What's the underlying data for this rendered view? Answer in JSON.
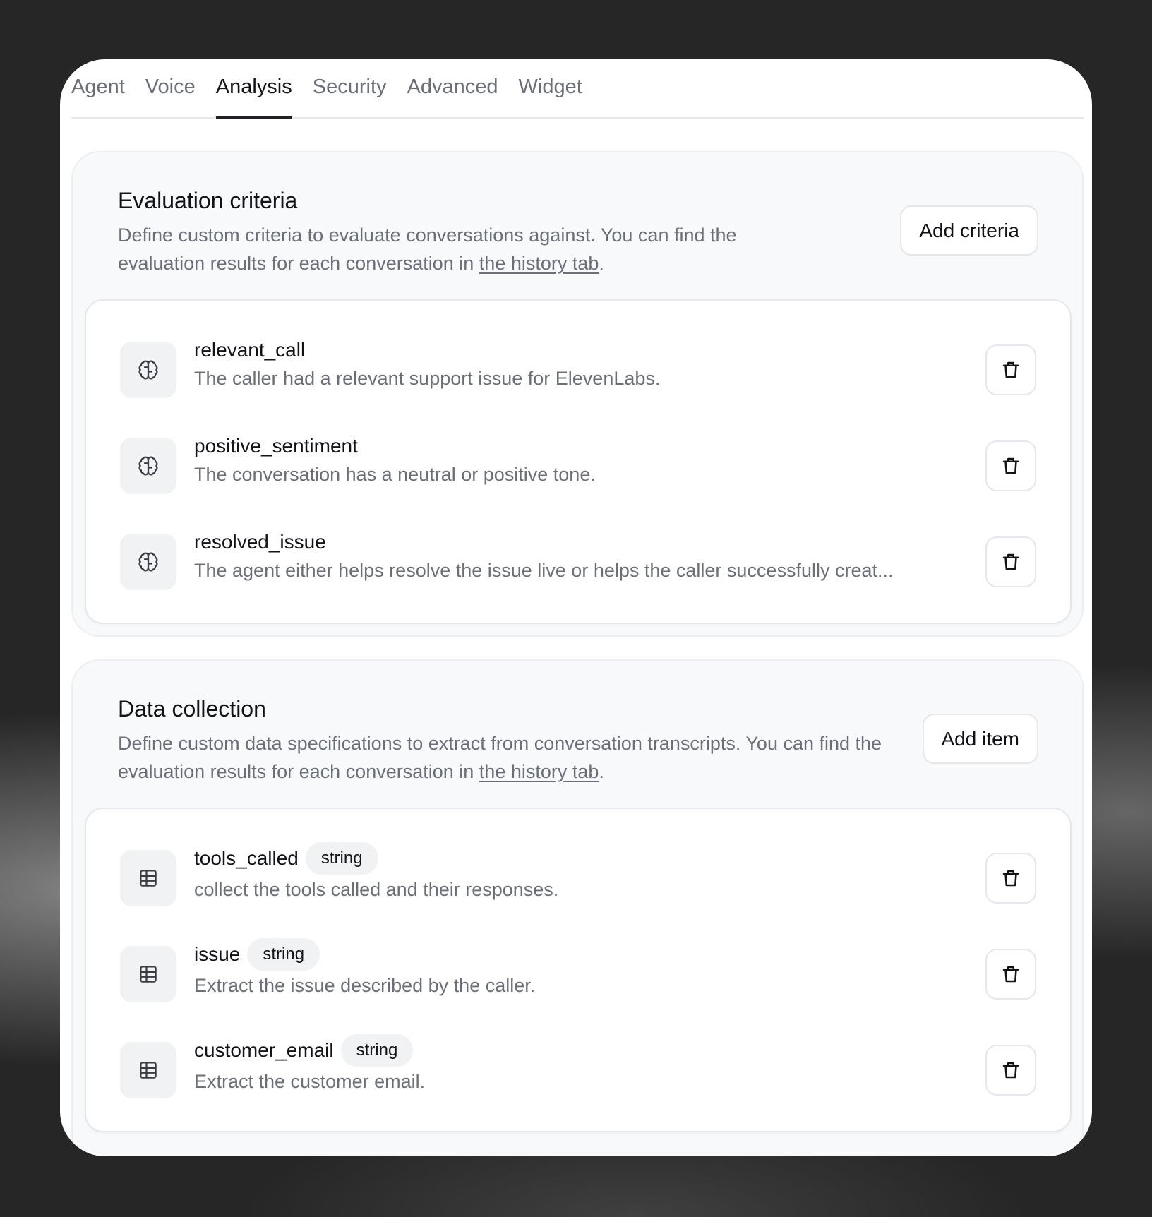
{
  "tabs": [
    {
      "label": "Agent",
      "active": false
    },
    {
      "label": "Voice",
      "active": false
    },
    {
      "label": "Analysis",
      "active": true
    },
    {
      "label": "Security",
      "active": false
    },
    {
      "label": "Advanced",
      "active": false
    },
    {
      "label": "Widget",
      "active": false
    }
  ],
  "evaluation": {
    "title": "Evaluation criteria",
    "description_prefix": "Define custom criteria to evaluate conversations against. You can find the evaluation results for each conversation in ",
    "link_text": "the history tab",
    "description_suffix": ".",
    "add_button": "Add criteria",
    "items": [
      {
        "name": "relevant_call",
        "description": "The caller had a relevant support issue for ElevenLabs.",
        "icon": "brain-icon"
      },
      {
        "name": "positive_sentiment",
        "description": "The conversation has a neutral or positive tone.",
        "icon": "brain-icon"
      },
      {
        "name": "resolved_issue",
        "description": "The agent either helps resolve the issue live or helps the caller successfully creat...",
        "icon": "brain-icon"
      }
    ]
  },
  "data_collection": {
    "title": "Data collection",
    "description_prefix": "Define custom data specifications to extract from conversation transcripts. You can find the evaluation results for each conversation in ",
    "link_text": "the history tab",
    "description_suffix": ".",
    "add_button": "Add item",
    "items": [
      {
        "name": "tools_called",
        "type": "string",
        "description": "collect the tools called and their responses.",
        "icon": "table-icon"
      },
      {
        "name": "issue",
        "type": "string",
        "description": "Extract the issue described by the caller.",
        "icon": "table-icon"
      },
      {
        "name": "customer_email",
        "type": "string",
        "description": "Extract the customer email.",
        "icon": "table-icon"
      }
    ]
  },
  "icons": {
    "criteria": "brain-icon",
    "data": "table-icon",
    "delete": "trash-icon"
  }
}
